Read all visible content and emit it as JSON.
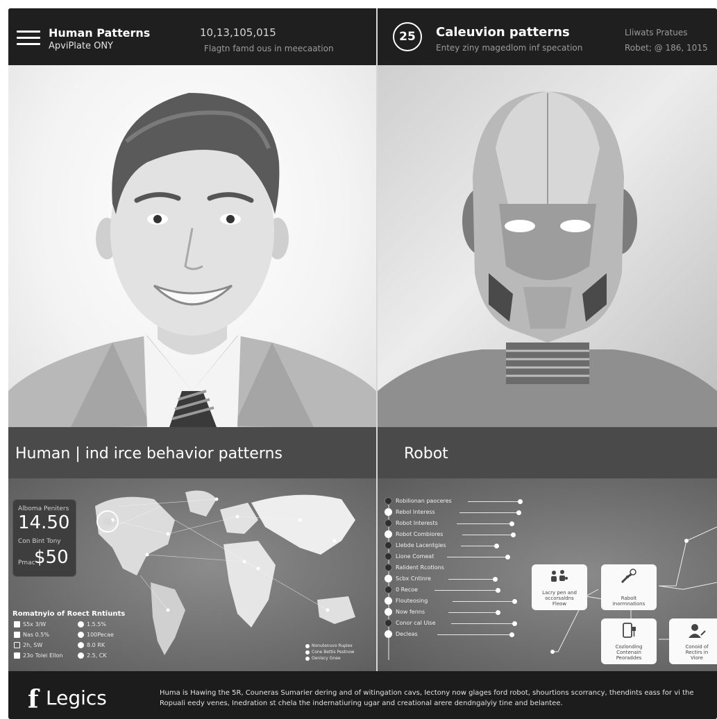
{
  "left_header": {
    "title": "Human Patterns",
    "subtitle": "ApviPlate ONY",
    "number": "10,13,105,015",
    "description": "Flagtn famd ous in meecaation"
  },
  "right_header": {
    "badge": "25",
    "title": "Caleuvion patterns",
    "subtitle": "Entey ziny magedlom inf specation",
    "meta_top": "Lliwats Pratues",
    "meta_bottom": "Robet; @ 186, 1015"
  },
  "left_section": {
    "title": "Human | ind irce behavior patterns"
  },
  "right_section": {
    "title": "Robot"
  },
  "stats": {
    "label_top": "Alboma Peniters",
    "value_top": "14.50",
    "label_mid": "Con Bint Tony",
    "prefix": "Pmac",
    "value_bottom": "$50"
  },
  "legend": {
    "title": "Romatnyio of Roect Rntiunts",
    "col1": [
      "S5x 3/W",
      "Nas 0.5%",
      "2h, SW",
      "23o Tolei Ellon"
    ],
    "col2": [
      "1.5.5%",
      "100Pecae",
      "8.0 RK",
      "2.5, CK"
    ],
    "map_legend": [
      "Nonutenuvo Ruplex",
      "Cone Bettis Pestnow",
      "Oeniscy Gnee"
    ]
  },
  "robot_list": [
    "Robilionan paoceres",
    "Rebol Interess",
    "Robot Interests",
    "Robot Combiores",
    "Llebde Lacentgies",
    "Lione Comeat",
    "Ralident Rcotlons",
    "Scbx Cntinre",
    "0 Recoe",
    "Flouteosing",
    "Now fenns",
    "Conor cal Uise",
    "Decleas"
  ],
  "flow_cards": [
    "Lacry pen and\noccorsaldns\nFleow",
    "Rabolt\nInorrnnations",
    "Cozlonding\nContenain\nPeoraddes",
    "Conoid of\nRectirs in\nViore"
  ],
  "footer": {
    "brand": "Legics",
    "text": "Huma is Hawing the 5R, Couneras Sumarier dering and of witingation cavs, Iectony now glages ford robot, shourtions scorrancy, thendints eass for vi the Ropuali eedy venes, Inedration st chela the indernatiuring ugar and creational arere dendngalyiy tine and belantee."
  },
  "colors": {
    "header_bg": "#1f1f1f",
    "section_bar": "#4a4a4a",
    "footer_bg": "#1c1c1c"
  }
}
